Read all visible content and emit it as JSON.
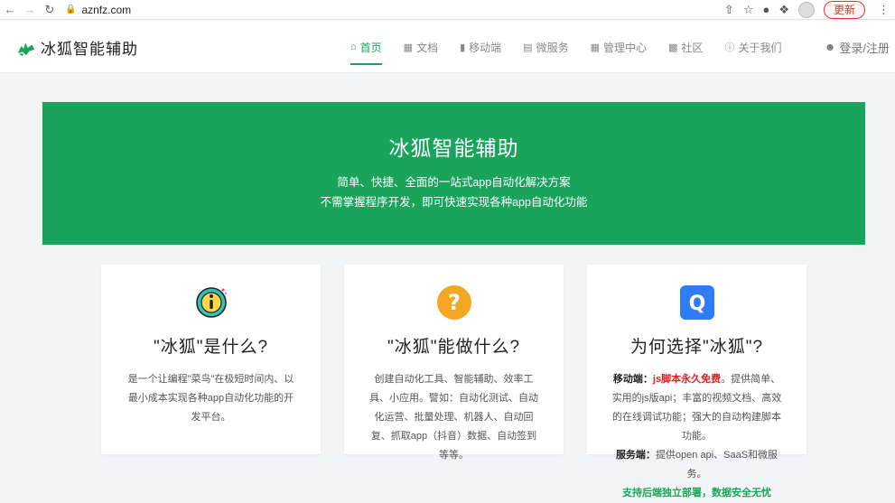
{
  "browser": {
    "url": "aznfz.com",
    "update_label": "更新",
    "colors": {
      "update": "#dd3333"
    }
  },
  "header": {
    "logo_text": "冰狐智能辅助",
    "nav": [
      {
        "label": "首页",
        "icon": "home-icon",
        "active": true
      },
      {
        "label": "文档",
        "icon": "book-icon",
        "active": false
      },
      {
        "label": "移动端",
        "icon": "mobile-icon",
        "active": false
      },
      {
        "label": "微服务",
        "icon": "server-icon",
        "active": false
      },
      {
        "label": "管理中心",
        "icon": "grid-icon",
        "active": false
      },
      {
        "label": "社区",
        "icon": "chat-icon",
        "active": false
      },
      {
        "label": "关于我们",
        "icon": "info-icon",
        "active": false
      }
    ],
    "login_label": "登录/注册"
  },
  "hero": {
    "title": "冰狐智能辅助",
    "line1": "简单、快捷、全面的一站式app自动化解决方案",
    "line2": "不需掌握程序开发，即可快速实现各种app自动化功能",
    "color": "#1aa35a"
  },
  "cards": [
    {
      "title": "\"冰狐\"是什么?",
      "body": "是一个让编程\"菜鸟\"在极短时间内、以最小成本实现各种app自动化功能的开发平台。",
      "icon": "info-circle-icon"
    },
    {
      "title": "\"冰狐\"能做什么?",
      "body": "创建自动化工具、智能辅助、效率工具、小应用。譬如：自动化测试、自动化运营、批量处理、机器人、自动回复、抓取app（抖音）数据、自动签到等等。",
      "icon": "question-circle-icon"
    },
    {
      "title": "为何选择\"冰狐\"?",
      "mobile_label": "移动端：",
      "mobile_highlight": "js脚本永久免费",
      "mobile_text": "。提供简单、实用的js版api；丰富的视频文档、高效的在线调试功能；强大的自动构建脚本功能。",
      "service_label": "服务端：",
      "service_text": "提供open api、SaaS和微服务。",
      "footer_highlight": "支持后端独立部署，数据安全无忧",
      "icon": "q-badge-icon"
    }
  ]
}
